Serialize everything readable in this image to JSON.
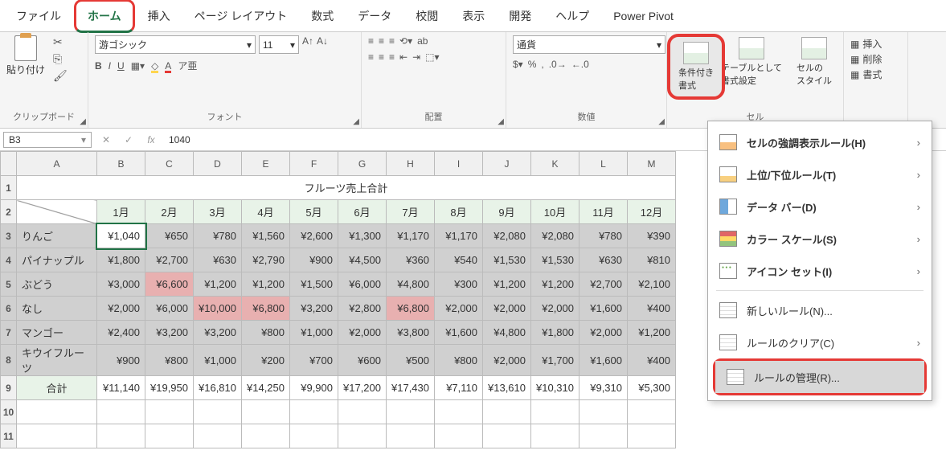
{
  "tabs": [
    "ファイル",
    "ホーム",
    "挿入",
    "ページ レイアウト",
    "数式",
    "データ",
    "校閲",
    "表示",
    "開発",
    "ヘルプ",
    "Power Pivot"
  ],
  "active_tab": 1,
  "ribbon": {
    "clipboard": {
      "paste": "貼り付け",
      "label": "クリップボード"
    },
    "font": {
      "name": "游ゴシック",
      "size": "11",
      "bold": "B",
      "italic": "I",
      "underline": "U",
      "label": "フォント"
    },
    "alignment": {
      "wrap": "ab",
      "label": "配置"
    },
    "number": {
      "format": "通貨",
      "label": "数値"
    },
    "styles": {
      "cond": "条件付き\n書式",
      "table": "テーブルとして\n書式設定",
      "cell": "セルの\nスタイル",
      "label": "セル"
    },
    "cells": {
      "insert": "挿入",
      "delete": "削除",
      "format": "書式"
    }
  },
  "namebox": "B3",
  "formula": "1040",
  "columns": [
    "A",
    "B",
    "C",
    "D",
    "E",
    "F",
    "G",
    "H",
    "I",
    "J",
    "K",
    "L",
    "M"
  ],
  "title": "フルーツ売上合計",
  "months": [
    "1月",
    "2月",
    "3月",
    "4月",
    "5月",
    "6月",
    "7月",
    "8月",
    "9月",
    "10月",
    "11月",
    "12月"
  ],
  "rows": [
    {
      "name": "りんご",
      "v": [
        "¥1,040",
        "¥650",
        "¥780",
        "¥1,560",
        "¥2,600",
        "¥1,300",
        "¥1,170",
        "¥1,170",
        "¥2,080",
        "¥2,080",
        "¥780",
        "¥390"
      ]
    },
    {
      "name": "パイナップル",
      "v": [
        "¥1,800",
        "¥2,700",
        "¥630",
        "¥2,790",
        "¥900",
        "¥4,500",
        "¥360",
        "¥540",
        "¥1,530",
        "¥1,530",
        "¥630",
        "¥810"
      ]
    },
    {
      "name": "ぶどう",
      "v": [
        "¥3,000",
        "¥6,600",
        "¥1,200",
        "¥1,200",
        "¥1,500",
        "¥6,000",
        "¥4,800",
        "¥300",
        "¥1,200",
        "¥1,200",
        "¥2,700",
        "¥2,100"
      ]
    },
    {
      "name": "なし",
      "v": [
        "¥2,000",
        "¥6,000",
        "¥10,000",
        "¥6,800",
        "¥3,200",
        "¥2,800",
        "¥6,800",
        "¥2,000",
        "¥2,000",
        "¥2,000",
        "¥1,600",
        "¥400"
      ]
    },
    {
      "name": "マンゴー",
      "v": [
        "¥2,400",
        "¥3,200",
        "¥3,200",
        "¥800",
        "¥1,000",
        "¥2,000",
        "¥3,800",
        "¥1,600",
        "¥4,800",
        "¥1,800",
        "¥2,000",
        "¥1,200"
      ]
    },
    {
      "name": "キウイフルーツ",
      "v": [
        "¥900",
        "¥800",
        "¥1,000",
        "¥200",
        "¥700",
        "¥600",
        "¥500",
        "¥800",
        "¥2,000",
        "¥1,700",
        "¥1,600",
        "¥400"
      ]
    }
  ],
  "total": {
    "name": "合計",
    "v": [
      "¥11,140",
      "¥19,950",
      "¥16,810",
      "¥14,250",
      "¥9,900",
      "¥17,200",
      "¥17,430",
      "¥7,110",
      "¥13,610",
      "¥10,310",
      "¥9,310",
      "¥5,300"
    ]
  },
  "highlights": [
    [
      2,
      1
    ],
    [
      3,
      2
    ],
    [
      3,
      3
    ],
    [
      3,
      6
    ]
  ],
  "dropdown": {
    "items": [
      {
        "label": "セルの強調表示ルール(H)",
        "icon": "i-highlight",
        "arrow": true
      },
      {
        "label": "上位/下位ルール(T)",
        "icon": "i-topbottom",
        "arrow": true
      },
      {
        "label": "データ バー(D)",
        "icon": "i-databar",
        "arrow": true
      },
      {
        "label": "カラー スケール(S)",
        "icon": "i-colorscale",
        "arrow": true
      },
      {
        "label": "アイコン セット(I)",
        "icon": "i-iconset",
        "arrow": true
      }
    ],
    "items2": [
      {
        "label": "新しいルール(N)...",
        "icon": "i-new"
      },
      {
        "label": "ルールのクリア(C)",
        "icon": "i-clear",
        "arrow": true
      },
      {
        "label": "ルールの管理(R)...",
        "icon": "i-manage",
        "hl": true
      }
    ]
  }
}
